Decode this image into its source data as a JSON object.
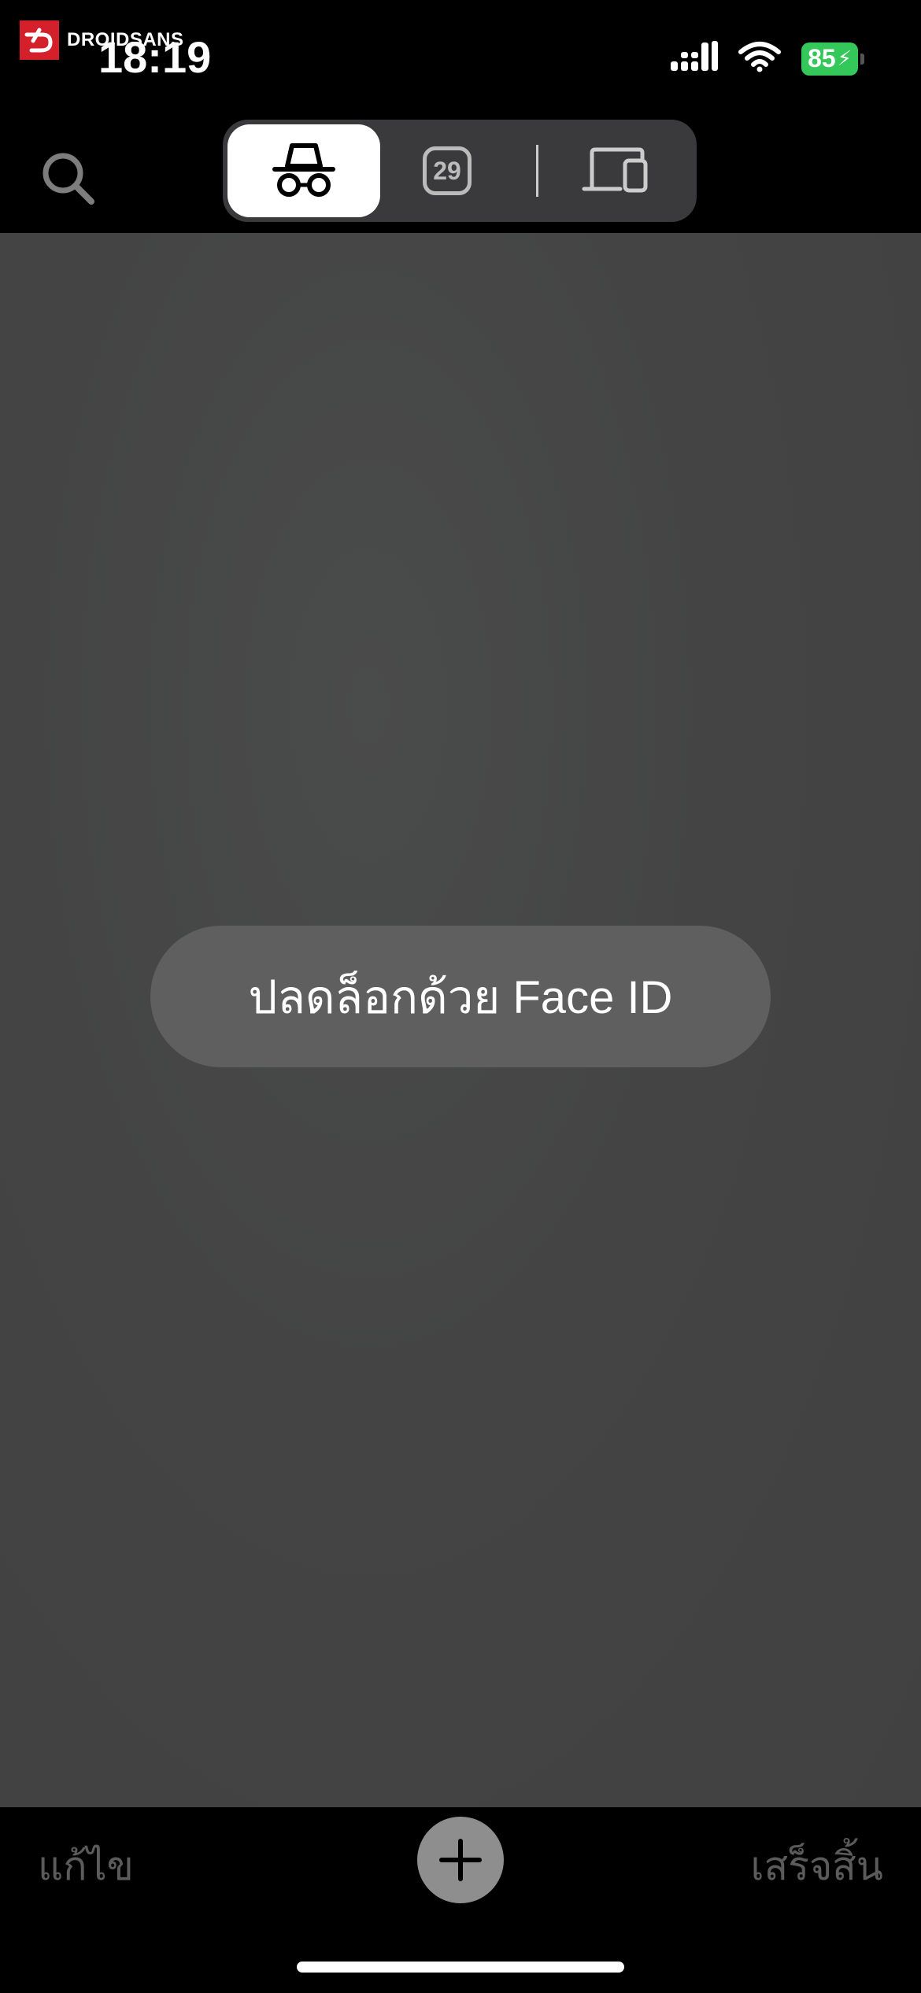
{
  "watermark": {
    "brand": "DROIDSANS"
  },
  "status_bar": {
    "time": "18:19",
    "battery_level": "85",
    "signal_icon": "cellular-signal-icon",
    "wifi_icon": "wifi-icon",
    "charging_icon": "bolt-icon"
  },
  "toolbar": {
    "search_icon": "search-icon",
    "tab_groups": {
      "private_icon": "incognito-icon",
      "tab_count": "29",
      "devices_icon": "devices-icon"
    }
  },
  "main": {
    "unlock_label": "ปลดล็อกด้วย Face ID"
  },
  "bottom_bar": {
    "edit_label": "แก้ไข",
    "add_icon": "plus-icon",
    "done_label": "เสร็จสิ้น"
  },
  "colors": {
    "accent_battery": "#34c759",
    "brand_red": "#d3202b",
    "content_bg": "#434343",
    "unlock_button_bg": "#5f5f5f"
  }
}
